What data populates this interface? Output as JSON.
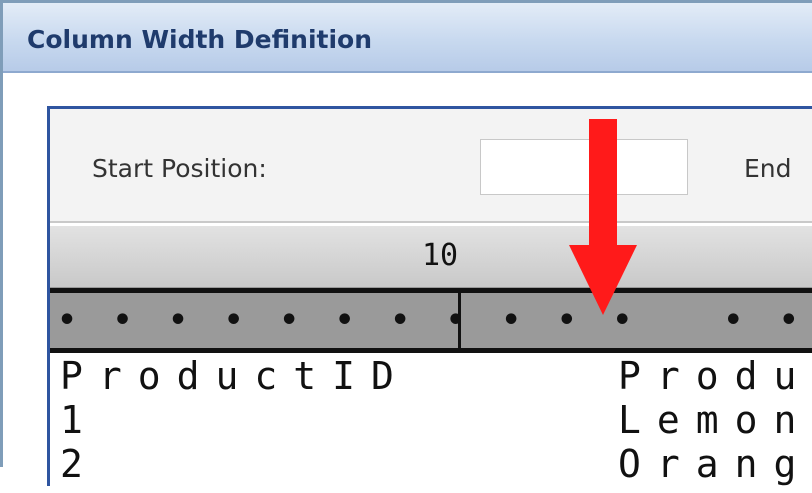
{
  "window": {
    "title": "Column Width Definition"
  },
  "toolbar": {
    "start_label": "Start Position:",
    "start_value": "",
    "end_label": "End"
  },
  "ruler": {
    "tick_label": "10",
    "dots": "·········|··········"
  },
  "columns": [
    "ProductID",
    "Produ"
  ],
  "rows": [
    [
      "1",
      "Lemon"
    ],
    [
      "2",
      "Orang"
    ]
  ],
  "colors": {
    "title_bg": "#c8d9ef",
    "panel_border": "#2f55a0",
    "arrow": "#ff1a1a"
  },
  "icons": {
    "annotation": "down-arrow-icon"
  }
}
